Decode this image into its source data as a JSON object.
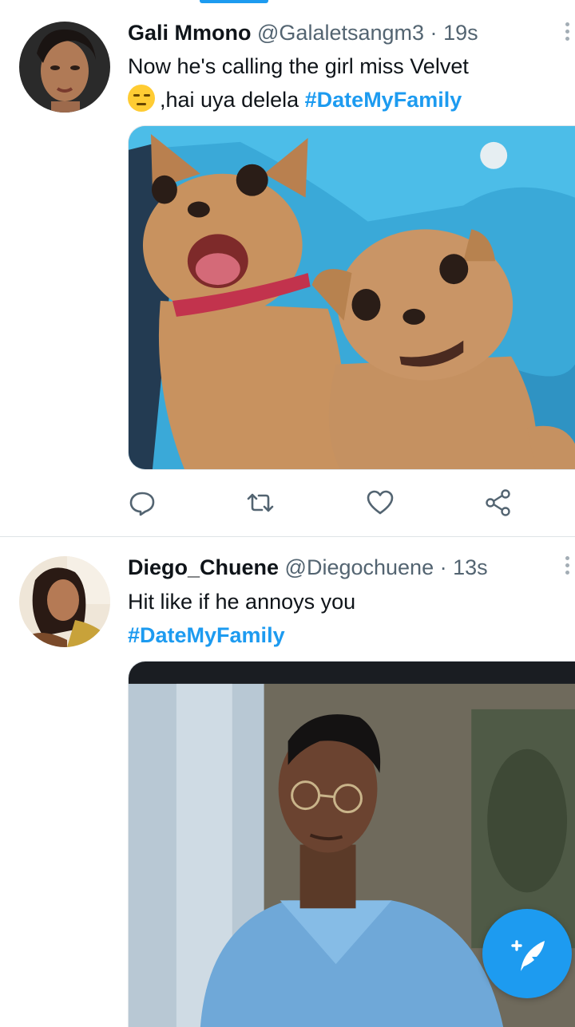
{
  "colors": {
    "accent": "#1d9bf0",
    "text": "#0f1419",
    "secondary": "#536471"
  },
  "tweets": [
    {
      "name": "Gali Mmono",
      "handle": "@Galaletsangm3",
      "separator": "·",
      "time": "19s",
      "line1": "Now he's calling the girl miss Velvet",
      "emoji": "expressionless-face-emoji",
      "line2": ",hai uya delela",
      "hashtag": "#DateMyFamily",
      "media": "two-chihuahuas-photo"
    },
    {
      "name": "Diego_Chuene",
      "handle": "@Diegochuene",
      "separator": "·",
      "time": "13s",
      "line1": "Hit like if  he annoys you",
      "hashtag": "#DateMyFamily",
      "media": "tv-screen-man-glasses-photo"
    }
  ],
  "actions": [
    "reply-icon",
    "retweet-icon",
    "like-icon",
    "share-icon"
  ],
  "fab": {
    "icon": "compose-tweet-icon"
  }
}
